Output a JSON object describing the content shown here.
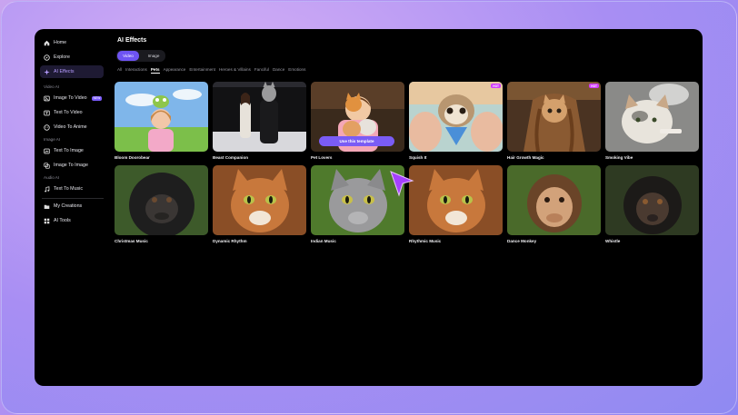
{
  "sidebar": {
    "items": [
      {
        "label": "Home",
        "icon": "home-icon"
      },
      {
        "label": "Explore",
        "icon": "compass-icon"
      },
      {
        "label": "AI Effects",
        "icon": "sparkle-icon"
      }
    ],
    "video_ai": {
      "heading": "Video AI",
      "items": [
        {
          "label": "Image To Video",
          "icon": "image-video-icon",
          "badge": "NEW"
        },
        {
          "label": "Text To Video",
          "icon": "text-video-icon"
        },
        {
          "label": "Video To Anime",
          "icon": "anime-icon"
        }
      ]
    },
    "image_ai": {
      "heading": "Image AI",
      "items": [
        {
          "label": "Text To Image",
          "icon": "text-image-icon"
        },
        {
          "label": "Image To Image",
          "icon": "image-image-icon"
        }
      ]
    },
    "audio_ai": {
      "heading": "Audio AI",
      "items": [
        {
          "label": "Text To Music",
          "icon": "music-note-icon"
        }
      ]
    },
    "bottom": [
      {
        "label": "My Creations",
        "icon": "folder-icon"
      },
      {
        "label": "AI Tools",
        "icon": "grid-icon"
      }
    ]
  },
  "main": {
    "title": "AI Effects",
    "media_tabs": [
      "Video",
      "Image"
    ],
    "categories": [
      "All",
      "Interactions",
      "Pets",
      "Appearance",
      "Entertainment",
      "Heroes & Villains",
      "Fanciful",
      "Dance",
      "Emotions"
    ],
    "active_category": "Pets",
    "hover_button": "Use this template",
    "badge_text": "HOT",
    "cards": [
      {
        "title": "Bloom Doorobear"
      },
      {
        "title": "Beast Companion"
      },
      {
        "title": "Pet Lovers"
      },
      {
        "title": "Squish It"
      },
      {
        "title": "Hair Growth Magic"
      },
      {
        "title": "Smoking Vibe"
      },
      {
        "title": "Christmas Music"
      },
      {
        "title": "Dynamic Rhythm"
      },
      {
        "title": "Indian Music"
      },
      {
        "title": "Rhythmic Music"
      },
      {
        "title": "Dance Monkey"
      },
      {
        "title": "Whistle"
      }
    ]
  },
  "colors": {
    "accent": "#6e54f2",
    "hot_badge": "#d13cff",
    "background": "#000000"
  }
}
